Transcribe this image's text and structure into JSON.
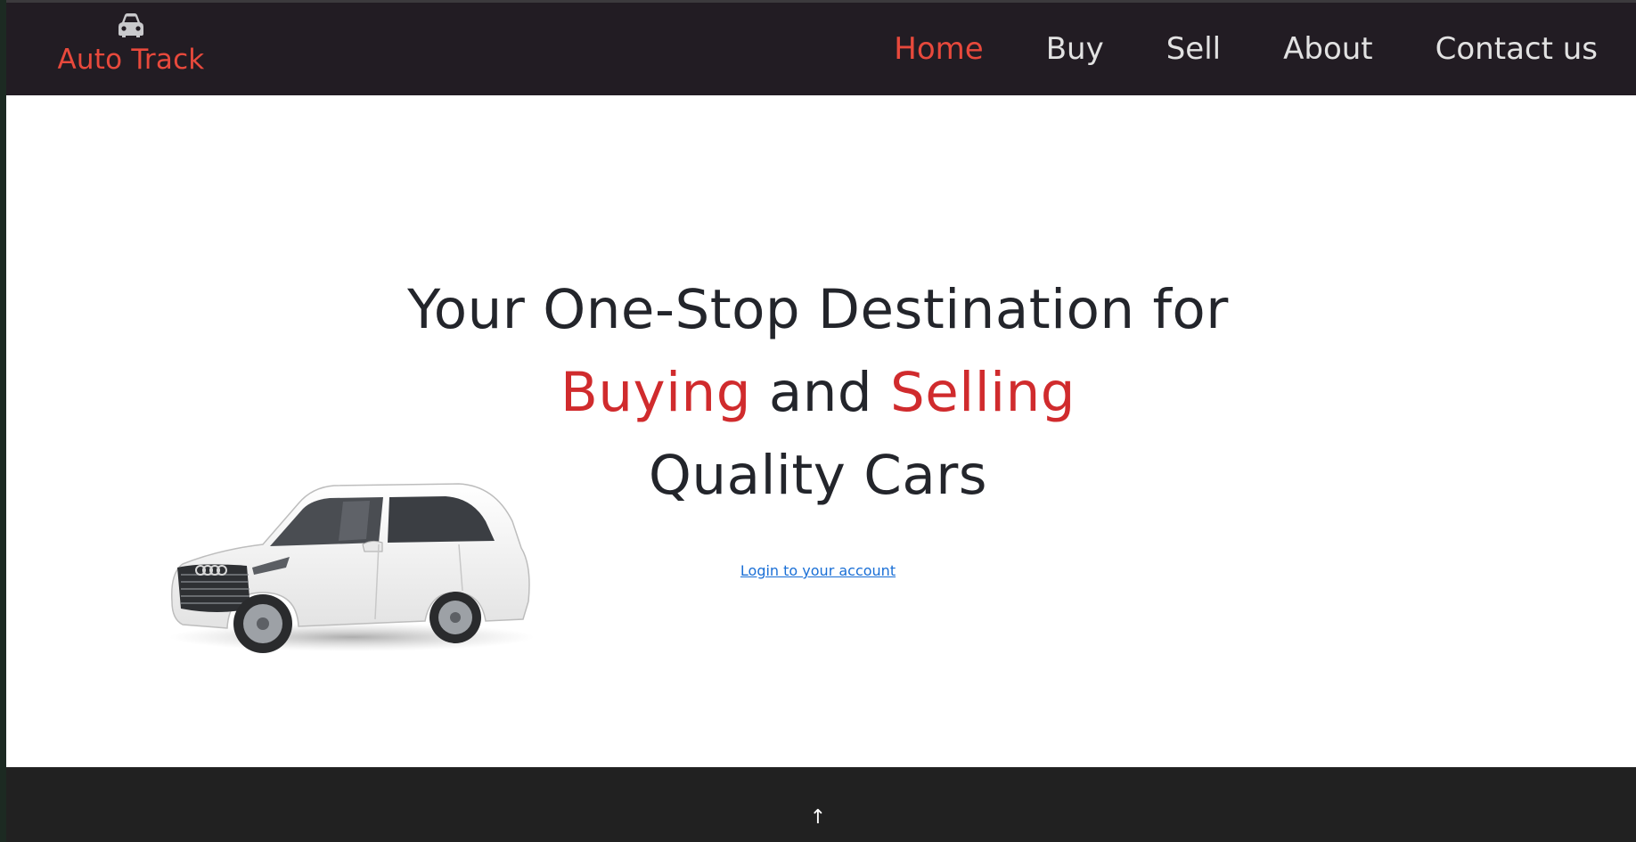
{
  "brand": {
    "name": "Auto Track",
    "icon": "car-icon",
    "color": "#e8493c"
  },
  "nav": {
    "items": [
      {
        "label": "Home",
        "active": true
      },
      {
        "label": "Buy",
        "active": false
      },
      {
        "label": "Sell",
        "active": false
      },
      {
        "label": "About",
        "active": false
      },
      {
        "label": "Contact us",
        "active": false
      }
    ]
  },
  "hero": {
    "line1": "Your One-Stop Destination for",
    "line2_part1": "Buying",
    "line2_part2": " and ",
    "line2_part3": "Selling",
    "line3": "Quality Cars",
    "accent_color": "#d02b2d",
    "login_link": "Login to your account",
    "image": "white-suv-car"
  },
  "footer": {
    "to_top": "↑"
  }
}
